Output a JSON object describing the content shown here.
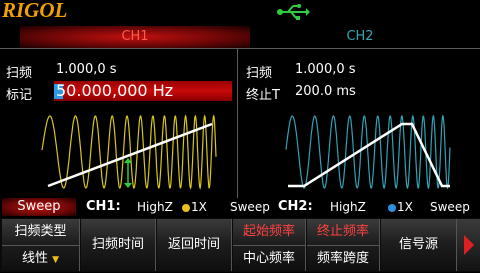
{
  "header": {
    "logo": "RIGOL",
    "usb_icon": "usb-icon"
  },
  "tabs": {
    "ch1": "CH1",
    "ch2": "CH2"
  },
  "ch1": {
    "sweep_label": "扫频",
    "sweep_value": "1.000,0 s",
    "marker_label": "标记",
    "marker_value": "50.000,000 Hz"
  },
  "ch2": {
    "sweep_label": "扫频",
    "sweep_value": "1.000,0 s",
    "stop_label": "终止T",
    "stop_value": "200.0 ms"
  },
  "status": {
    "mode": "Sweep",
    "ch1_label": "CH1:",
    "ch1_imp": "HighZ",
    "ch1_probe": "1X",
    "ch1_mode": "Sweep",
    "ch2_label": "CH2:",
    "ch2_imp": "HighZ",
    "ch2_probe": "1X",
    "ch2_mode": "Sweep"
  },
  "softkeys": {
    "sweep_type": "扫频类型",
    "sweep_type_value": "线性",
    "sweep_time": "扫频时间",
    "return_time": "返回时间",
    "start_freq": "起始频率",
    "center_freq": "中心频率",
    "stop_freq": "终止频率",
    "freq_span": "频率跨度",
    "signal_source": "信号源"
  },
  "colors": {
    "ch1": "#d8c81a",
    "ch2": "#2fa3b5",
    "accent_red": "#c80a0a"
  }
}
